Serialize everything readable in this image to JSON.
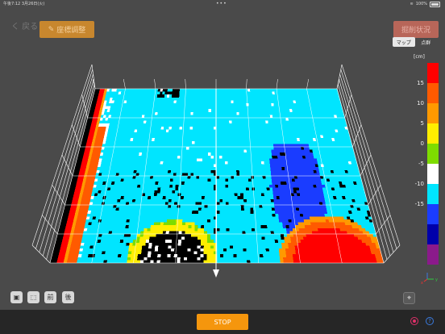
{
  "status_bar": {
    "time": "午後7:12",
    "date": "3月26日(火)",
    "battery": "100%"
  },
  "header": {
    "back_label": "く 戻る",
    "coord_label": "座標調整",
    "status_label": "掘削状況"
  },
  "view_toggle": {
    "options": [
      "マップ",
      "点群"
    ],
    "selected": "マップ"
  },
  "legend": {
    "unit": "[cm]",
    "labels": [
      "15",
      "10",
      "5",
      "0",
      "-5",
      "-10",
      "-15"
    ],
    "colors": [
      "#ff0000",
      "#ff5a00",
      "#ff9900",
      "#ffee00",
      "#7edc00",
      "#ffffff",
      "#00e5ff",
      "#1a3cff",
      "#0000aa",
      "#8b1a8b"
    ]
  },
  "toolbar": {
    "front_label": "前",
    "back_label": "後"
  },
  "bottom": {
    "stop_label": "STOP",
    "help_label": "?"
  },
  "axes": {
    "x": "x",
    "y": "y"
  }
}
